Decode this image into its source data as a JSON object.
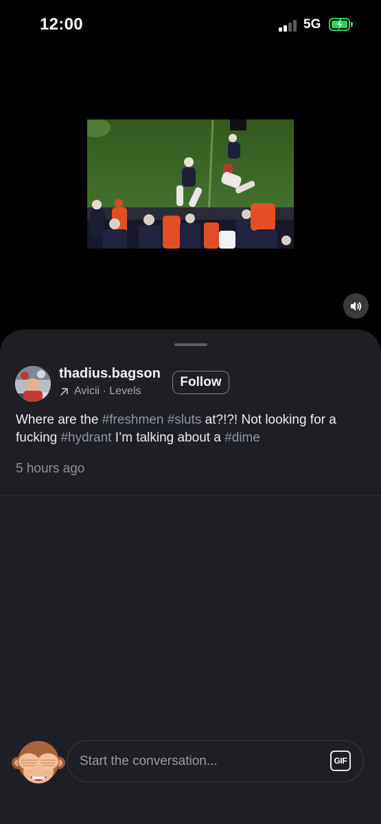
{
  "status_bar": {
    "time": "12:00",
    "network": "5G",
    "signal_bars_active": 2,
    "signal_bars_total": 4,
    "battery_charging": true,
    "battery_color": "#30d158"
  },
  "video": {
    "sound_icon": "speaker-icon"
  },
  "post": {
    "username": "thadius.bagson",
    "song": "Avicii · Levels",
    "song_icon": "arrow-up-right-icon",
    "follow_label": "Follow",
    "text_segments": [
      {
        "text": "Where are the ",
        "hashtag": false
      },
      {
        "text": "#freshmen",
        "hashtag": true
      },
      {
        "text": " ",
        "hashtag": false
      },
      {
        "text": "#sluts",
        "hashtag": true
      },
      {
        "text": " at?!?! Not looking for a fucking ",
        "hashtag": false
      },
      {
        "text": "#hydrant",
        "hashtag": true
      },
      {
        "text": " I’m talking about a ",
        "hashtag": false
      },
      {
        "text": "#dime",
        "hashtag": true
      }
    ],
    "timestamp": "5 hours ago"
  },
  "composer": {
    "placeholder": "Start the conversation...",
    "gif_label": "GIF",
    "avatar_icon": "see-no-evil-monkey-icon"
  },
  "colors": {
    "sheet_bg": "#1e1f24",
    "hashtag": "#8e96a8",
    "muted_text": "#8f9198"
  }
}
